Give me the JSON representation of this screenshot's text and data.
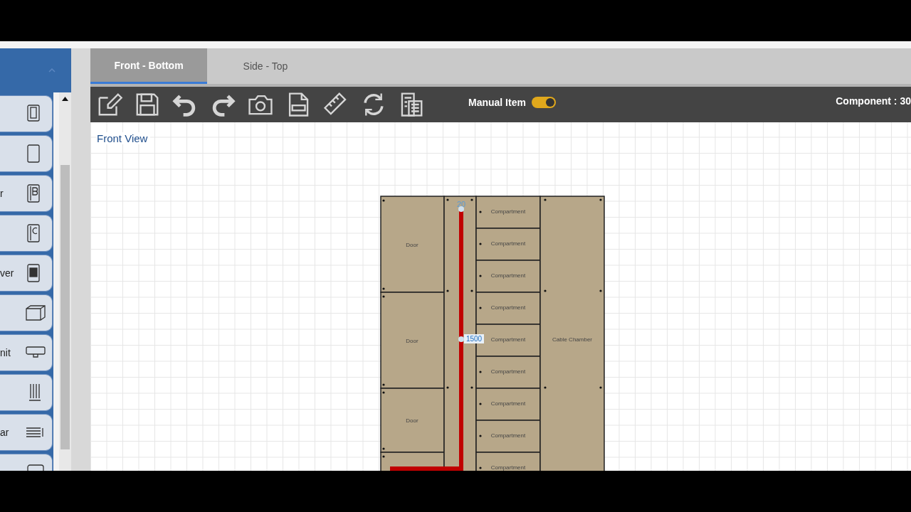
{
  "sidebar": {
    "items": [
      {
        "kind": "lock"
      },
      {
        "kind": "panel"
      },
      {
        "kind": "b",
        "label": "r"
      },
      {
        "kind": "c"
      },
      {
        "kind": "drawer",
        "label": "ver"
      },
      {
        "kind": "box"
      },
      {
        "kind": "unit",
        "label": "nit"
      },
      {
        "kind": "bars"
      },
      {
        "kind": "busbar",
        "label": "ar"
      },
      {
        "kind": "partial"
      }
    ]
  },
  "tabs": [
    {
      "label": "Front - Bottom",
      "selected": true
    },
    {
      "label": "Side - Top",
      "selected": false
    }
  ],
  "toolbar": {
    "toggle": {
      "label": "Manual Item",
      "on": true
    },
    "component": "Component : 30"
  },
  "view_title": "Front View",
  "drawing": {
    "doors": [
      {
        "label": "Door"
      },
      {
        "label": "Door"
      },
      {
        "label": "Door"
      }
    ],
    "busbar": {
      "top_label": "20",
      "mid_label": "1500"
    },
    "compartments": [
      "Compartment",
      "Compartment",
      "Compartment",
      "Compartment",
      "Compartment",
      "Compartment",
      "Compartment",
      "Compartment",
      "Compartment"
    ],
    "cable_chamber": "Cable Chamber"
  }
}
